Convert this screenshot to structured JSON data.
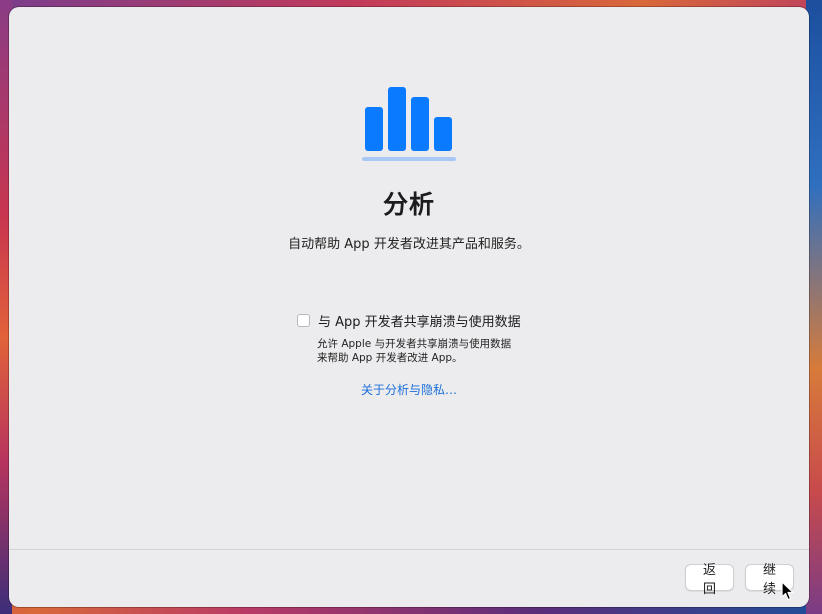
{
  "header": {
    "icon": "bar-chart-icon",
    "title": "分析",
    "subtitle": "自动帮助 App 开发者改进其产品和服务。"
  },
  "share": {
    "checkbox_label": "与 App 开发者共享崩溃与使用数据",
    "checked": false,
    "description_line1": "允许 Apple 与开发者共享崩溃与使用数据",
    "description_line2": "来帮助 App 开发者改进 App。"
  },
  "privacy_link": "关于分析与隐私…",
  "footer": {
    "back_label": "返回",
    "continue_label": "继续"
  },
  "colors": {
    "accent": "#0a7aff",
    "accent_light": "#a8c8f5",
    "link": "#1a6fd8",
    "window_bg": "#ececee"
  }
}
